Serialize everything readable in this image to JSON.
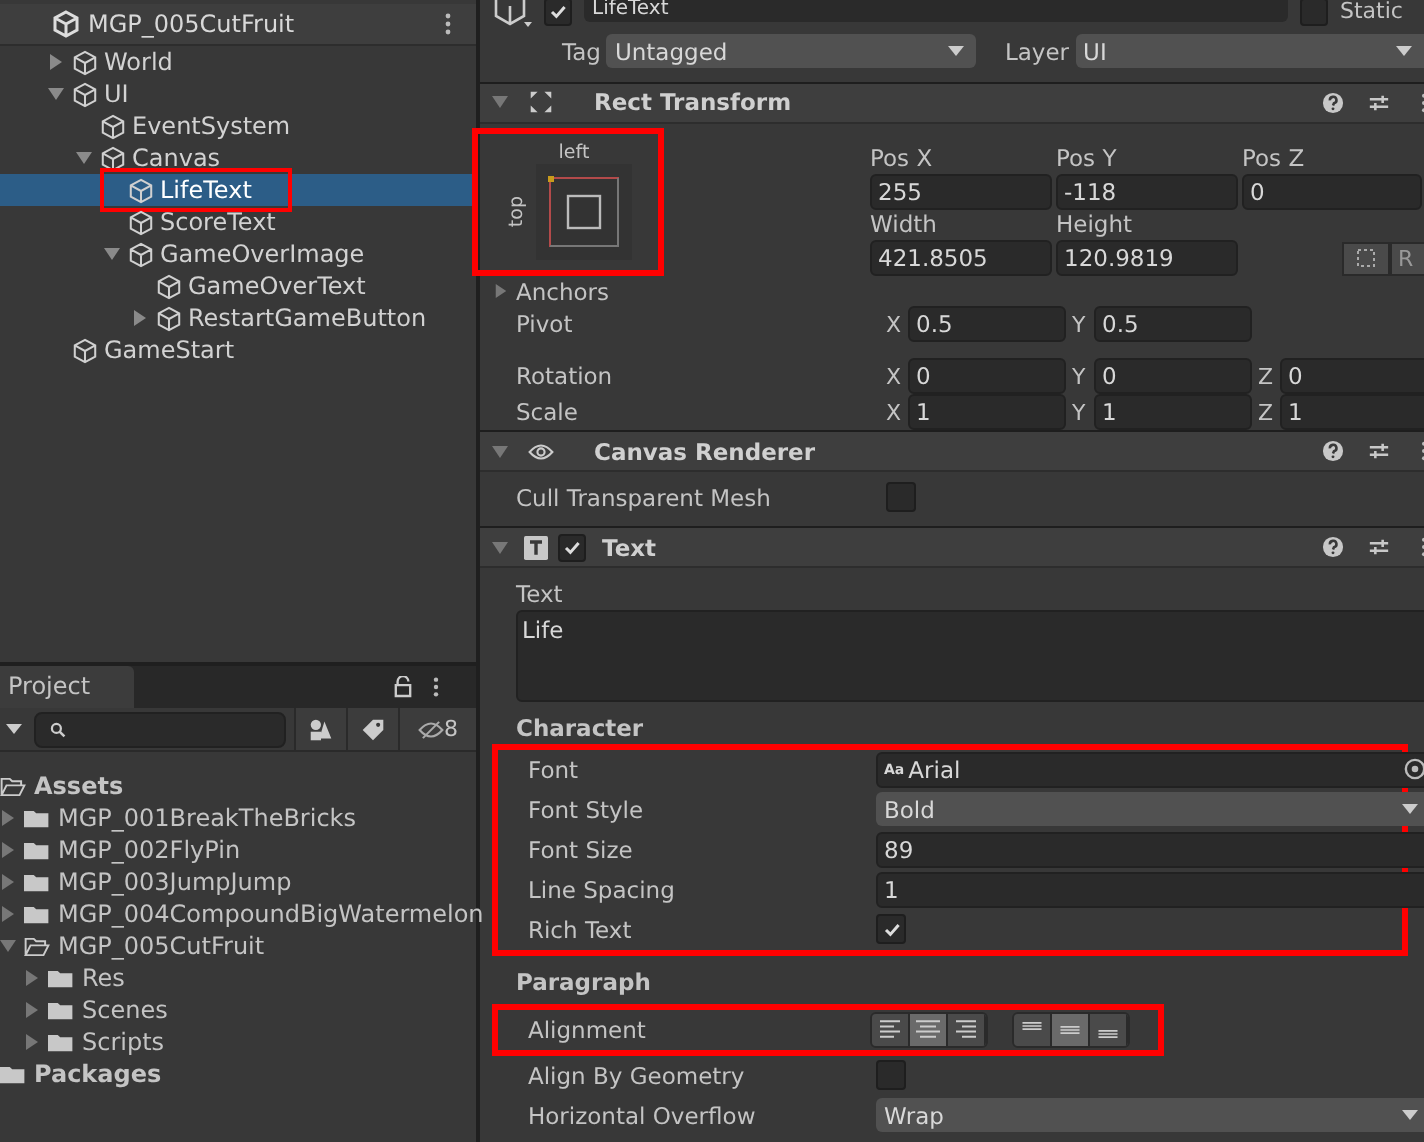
{
  "hierarchy": {
    "scene": "MGP_005CutFruit",
    "items": [
      {
        "label": "World",
        "kind": "node",
        "expanded": false,
        "selected": false
      },
      {
        "label": "UI",
        "kind": "node",
        "expanded": true,
        "selected": false,
        "children": [
          {
            "label": "EventSystem",
            "kind": "leaf",
            "selected": false
          },
          {
            "label": "Canvas",
            "kind": "node",
            "expanded": true,
            "selected": false,
            "children": [
              {
                "label": "LifeText",
                "kind": "leaf",
                "selected": true,
                "highlighted": true
              },
              {
                "label": "ScoreText",
                "kind": "leaf",
                "selected": false
              },
              {
                "label": "GameOverImage",
                "kind": "node",
                "expanded": true,
                "selected": false,
                "children": [
                  {
                    "label": "GameOverText",
                    "kind": "leaf",
                    "selected": false
                  },
                  {
                    "label": "RestartGameButton",
                    "kind": "node",
                    "expanded": false,
                    "selected": false
                  }
                ]
              }
            ]
          }
        ]
      },
      {
        "label": "GameStart",
        "kind": "leaf",
        "selected": false
      }
    ]
  },
  "project": {
    "tab": "Project",
    "hidden_count": "8",
    "items": [
      {
        "label": "Assets",
        "kind": "root",
        "expanded": true,
        "children": [
          {
            "label": "MGP_001BreakTheBricks",
            "kind": "node",
            "expanded": false
          },
          {
            "label": "MGP_002FlyPin",
            "kind": "node",
            "expanded": false
          },
          {
            "label": "MGP_003JumpJump",
            "kind": "node",
            "expanded": false
          },
          {
            "label": "MGP_004CompoundBigWatermelon",
            "kind": "node",
            "expanded": false
          },
          {
            "label": "MGP_005CutFruit",
            "kind": "node",
            "expanded": true,
            "children": [
              {
                "label": "Res",
                "kind": "node",
                "expanded": false
              },
              {
                "label": "Scenes",
                "kind": "node",
                "expanded": false
              },
              {
                "label": "Scripts",
                "kind": "node",
                "expanded": false
              }
            ]
          }
        ]
      },
      {
        "label": "Packages",
        "kind": "root",
        "expanded": false
      }
    ]
  },
  "inspector": {
    "object": {
      "name": "LifeText",
      "active": true,
      "static_label": "Static",
      "static": false,
      "tag_label": "Tag",
      "tag": "Untagged",
      "layer_label": "Layer",
      "layer": "UI"
    },
    "rect_transform": {
      "title": "Rect Transform",
      "anchor_h": "left",
      "anchor_v": "top",
      "highlighted": true,
      "position": [
        {
          "label": "Pos X",
          "value": "255"
        },
        {
          "label": "Pos Y",
          "value": "-118"
        },
        {
          "label": "Pos Z",
          "value": "0"
        }
      ],
      "size": [
        {
          "label": "Width",
          "value": "421.8505"
        },
        {
          "label": "Height",
          "value": "120.9819"
        }
      ],
      "raw_button": "R",
      "anchors": "Anchors",
      "vectors": [
        {
          "label": "Pivot",
          "axes": [
            {
              "axis": "X",
              "value": "0.5"
            },
            {
              "axis": "Y",
              "value": "0.5"
            }
          ]
        },
        {
          "label": "Rotation",
          "axes": [
            {
              "axis": "X",
              "value": "0"
            },
            {
              "axis": "Y",
              "value": "0"
            },
            {
              "axis": "Z",
              "value": "0"
            }
          ]
        },
        {
          "label": "Scale",
          "axes": [
            {
              "axis": "X",
              "value": "1"
            },
            {
              "axis": "Y",
              "value": "1"
            },
            {
              "axis": "Z",
              "value": "1"
            }
          ]
        }
      ]
    },
    "canvas_renderer": {
      "title": "Canvas Renderer",
      "label": "Cull Transparent Mesh",
      "checked": false
    },
    "text": {
      "title": "Text",
      "enabled": true,
      "text_label": "Text",
      "text_value": "Life",
      "sections": [
        {
          "heading": "Character",
          "highlighted": true,
          "rows": [
            {
              "kind": "object",
              "label": "Font",
              "icon": "Aa",
              "value": "Arial"
            },
            {
              "kind": "dropdown",
              "label": "Font Style",
              "value": "Bold"
            },
            {
              "kind": "field",
              "label": "Font Size",
              "value": "89"
            },
            {
              "kind": "field",
              "label": "Line Spacing",
              "value": "1"
            },
            {
              "kind": "checkbox",
              "label": "Rich Text",
              "checked": true
            }
          ]
        },
        {
          "heading": "Paragraph",
          "highlighted": false,
          "rows": [
            {
              "kind": "alignment",
              "label": "Alignment",
              "highlighted": true,
              "horizontal": [
                {
                  "kind": "left",
                  "selected": false
                },
                {
                  "kind": "center",
                  "selected": true
                },
                {
                  "kind": "right",
                  "selected": false
                }
              ],
              "vertical": [
                {
                  "kind": "upper",
                  "selected": false
                },
                {
                  "kind": "middle",
                  "selected": true
                },
                {
                  "kind": "lower",
                  "selected": false
                }
              ]
            },
            {
              "kind": "checkbox",
              "label": "Align By Geometry",
              "checked": false
            },
            {
              "kind": "dropdown",
              "label": "Horizontal Overflow",
              "value": "Wrap"
            }
          ]
        }
      ]
    }
  }
}
